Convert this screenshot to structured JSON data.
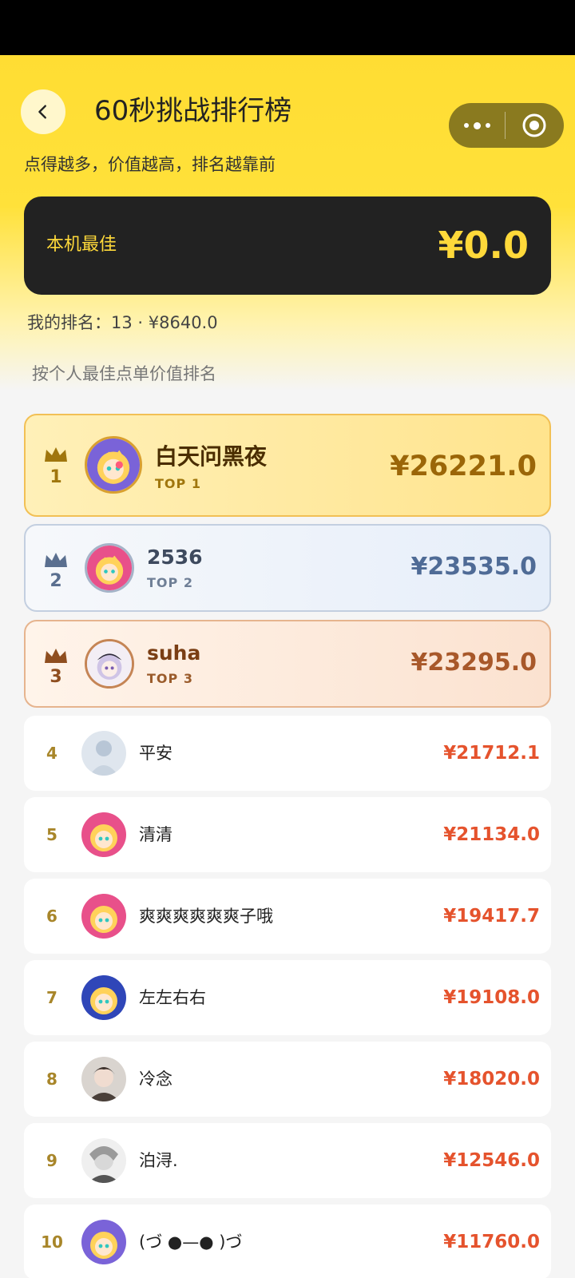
{
  "header": {
    "title": "60秒挑战排行榜",
    "subtitle": "点得越多，价值越高，排名越靠前"
  },
  "best": {
    "label": "本机最佳",
    "value": "¥0.0"
  },
  "my_rank": "我的排名：13 · ¥8640.0",
  "rank_note": "按个人最佳点单价值排名",
  "top3": [
    {
      "rank": "1",
      "name": "白天问黑夜",
      "tag": "TOP 1",
      "score": "¥26221.0"
    },
    {
      "rank": "2",
      "name": "2536",
      "tag": "TOP 2",
      "score": "¥23535.0"
    },
    {
      "rank": "3",
      "name": "suha",
      "tag": "TOP 3",
      "score": "¥23295.0"
    }
  ],
  "list": [
    {
      "rank": "4",
      "name": "平安",
      "score": "¥21712.1"
    },
    {
      "rank": "5",
      "name": "清清",
      "score": "¥21134.0"
    },
    {
      "rank": "6",
      "name": "爽爽爽爽爽爽子哦",
      "score": "¥19417.7"
    },
    {
      "rank": "7",
      "name": "左左右右",
      "score": "¥19108.0"
    },
    {
      "rank": "8",
      "name": "冷念",
      "score": "¥18020.0"
    },
    {
      "rank": "9",
      "name": "泊浔.",
      "score": "¥12546.0"
    },
    {
      "rank": "10",
      "name": "(づ ●—● )づ",
      "score": "¥11760.0"
    }
  ],
  "colors": {
    "brand_yellow": "#ffdd33",
    "best_card_bg": "#222222",
    "score_red": "#e5532d",
    "gold": "#a8862a"
  },
  "icons": [
    "back-icon",
    "more-icon",
    "capsule-target-icon",
    "crown-icon"
  ]
}
